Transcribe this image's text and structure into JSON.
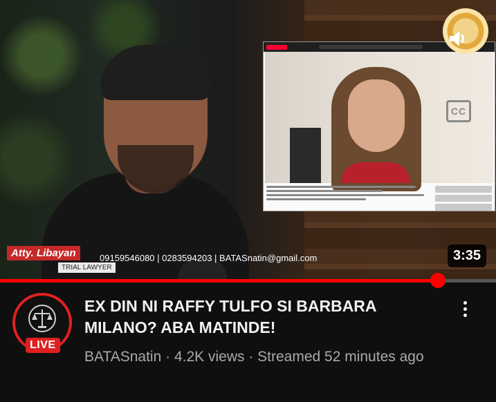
{
  "video": {
    "duration": "3:35",
    "progress_fraction": 0.883
  },
  "overlay": {
    "name": "Atty. Libayan",
    "role": "TRIAL LAWYER",
    "contacts": "09159546080 | 0283594203 | BATASnatin@gmail.com",
    "cc_label": "CC"
  },
  "channel": {
    "name": "BATASnatin",
    "live_label": "LIVE"
  },
  "title": "EX DIN NI RAFFY TULFO SI BARBARA MILANO? ABA MATINDE!",
  "meta": "BATASnatin · 4.2K views · Streamed 52 minutes ago",
  "colors": {
    "accent": "#ff0000",
    "background": "#0f0f0f",
    "title_text": "#f1f1f1",
    "meta_text": "#aaaaaa"
  },
  "icons": [
    "speaker-icon",
    "more-options-icon",
    "channel-emblem-icon",
    "closed-captions-icon"
  ]
}
